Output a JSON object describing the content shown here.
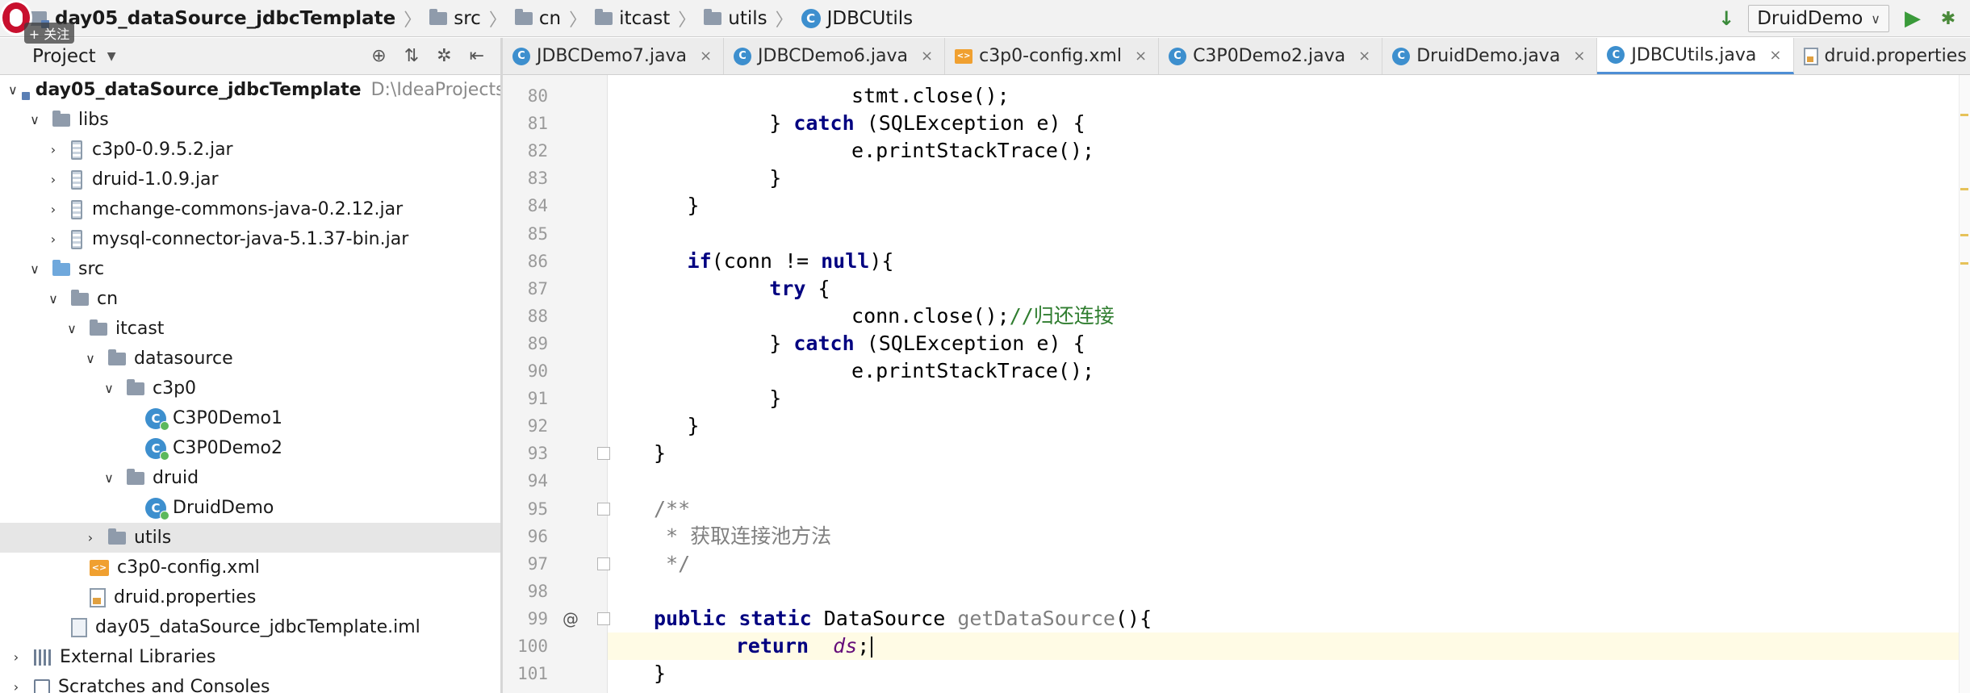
{
  "breadcrumb": {
    "items": [
      {
        "label": "day05_dataSource_jdbcTemplate",
        "icon": "module-icon",
        "bold": true
      },
      {
        "label": "src",
        "icon": "folder-icon"
      },
      {
        "label": "cn",
        "icon": "folder-icon"
      },
      {
        "label": "itcast",
        "icon": "folder-icon"
      },
      {
        "label": "utils",
        "icon": "folder-icon"
      },
      {
        "label": "JDBCUtils",
        "icon": "class-icon"
      }
    ],
    "separator": "〉"
  },
  "overlay": {
    "follow_label": "+ 关注"
  },
  "toolbar": {
    "run_config": "DruidDemo",
    "dropdown_glyph": "∨",
    "run_glyph": "▶",
    "debug_glyph": "✱",
    "build_glyph": "↓"
  },
  "project_panel": {
    "title": "Project",
    "tools": [
      "⊕",
      "⇅",
      "✲",
      "⇤"
    ],
    "tree": [
      {
        "label": "day05_dataSource_jdbcTemplate",
        "path": "D:\\IdeaProjects\\",
        "icon": "module-icon",
        "arrow": "∨",
        "level": 0,
        "bold": true
      },
      {
        "label": "libs",
        "icon": "folder-icon",
        "arrow": "∨",
        "level": 1
      },
      {
        "label": "c3p0-0.9.5.2.jar",
        "icon": "jar-icon",
        "arrow": "›",
        "level": 2
      },
      {
        "label": "druid-1.0.9.jar",
        "icon": "jar-icon",
        "arrow": "›",
        "level": 2
      },
      {
        "label": "mchange-commons-java-0.2.12.jar",
        "icon": "jar-icon",
        "arrow": "›",
        "level": 2
      },
      {
        "label": "mysql-connector-java-5.1.37-bin.jar",
        "icon": "jar-icon",
        "arrow": "›",
        "level": 2
      },
      {
        "label": "src",
        "icon": "source-folder-icon",
        "arrow": "∨",
        "level": 1
      },
      {
        "label": "cn",
        "icon": "folder-icon",
        "arrow": "∨",
        "level": 2
      },
      {
        "label": "itcast",
        "icon": "folder-icon",
        "arrow": "∨",
        "level": 3
      },
      {
        "label": "datasource",
        "icon": "folder-icon",
        "arrow": "∨",
        "level": 4
      },
      {
        "label": "c3p0",
        "icon": "folder-icon",
        "arrow": "∨",
        "level": 5
      },
      {
        "label": "C3P0Demo1",
        "icon": "class-icon",
        "arrow": "",
        "level": 6
      },
      {
        "label": "C3P0Demo2",
        "icon": "class-icon",
        "arrow": "",
        "level": 6
      },
      {
        "label": "druid",
        "icon": "folder-icon",
        "arrow": "∨",
        "level": 5
      },
      {
        "label": "DruidDemo",
        "icon": "class-icon",
        "arrow": "",
        "level": 6
      },
      {
        "label": "utils",
        "icon": "folder-icon",
        "arrow": "›",
        "level": 4,
        "selected": true
      },
      {
        "label": "c3p0-config.xml",
        "icon": "xml-icon",
        "arrow": "",
        "level": 3
      },
      {
        "label": "druid.properties",
        "icon": "properties-icon",
        "arrow": "",
        "level": 3
      },
      {
        "label": "day05_dataSource_jdbcTemplate.iml",
        "icon": "iml-icon",
        "arrow": "",
        "level": 2
      },
      {
        "label": "External Libraries",
        "icon": "libraries-icon",
        "arrow": "›",
        "level": 0
      },
      {
        "label": "Scratches and Consoles",
        "icon": "scratches-icon",
        "arrow": "›",
        "level": 0
      }
    ]
  },
  "editor_tabs": {
    "tabs": [
      {
        "label": "JDBCDemo7.java",
        "icon": "class-icon",
        "active": false
      },
      {
        "label": "JDBCDemo6.java",
        "icon": "class-icon",
        "active": false
      },
      {
        "label": "c3p0-config.xml",
        "icon": "xml-icon",
        "active": false
      },
      {
        "label": "C3P0Demo2.java",
        "icon": "class-icon",
        "active": false
      },
      {
        "label": "DruidDemo.java",
        "icon": "class-icon",
        "active": false
      },
      {
        "label": "JDBCUtils.java",
        "icon": "class-icon",
        "active": true
      },
      {
        "label": "druid.properties",
        "icon": "properties-icon",
        "active": false
      }
    ],
    "close_glyph": "×",
    "menu_glyph": "≡"
  },
  "editor": {
    "current_line": "100",
    "lines": [
      {
        "num": "80",
        "code": [
          {
            "t": "        stmt.close();",
            "c": ""
          }
        ]
      },
      {
        "num": "81",
        "code": [
          {
            "t": "    } ",
            "c": ""
          },
          {
            "t": "catch",
            "c": "kw"
          },
          {
            "t": " (SQLException e) {",
            "c": ""
          }
        ]
      },
      {
        "num": "82",
        "code": [
          {
            "t": "        e.printStackTrace();",
            "c": ""
          }
        ]
      },
      {
        "num": "83",
        "code": [
          {
            "t": "    }",
            "c": ""
          }
        ]
      },
      {
        "num": "84",
        "code": [
          {
            "t": "}",
            "c": ""
          }
        ]
      },
      {
        "num": "85",
        "code": []
      },
      {
        "num": "86",
        "code": [
          {
            "t": "if",
            "c": "kw"
          },
          {
            "t": "(conn != ",
            "c": ""
          },
          {
            "t": "null",
            "c": "kw"
          },
          {
            "t": "){",
            "c": ""
          }
        ]
      },
      {
        "num": "87",
        "code": [
          {
            "t": "    ",
            "c": ""
          },
          {
            "t": "try",
            "c": "kw"
          },
          {
            "t": " {",
            "c": ""
          }
        ]
      },
      {
        "num": "88",
        "code": [
          {
            "t": "        conn.close();",
            "c": ""
          },
          {
            "t": "//归还连接",
            "c": "cm-cn"
          }
        ]
      },
      {
        "num": "89",
        "code": [
          {
            "t": "    } ",
            "c": ""
          },
          {
            "t": "catch",
            "c": "kw"
          },
          {
            "t": " (SQLException e) {",
            "c": ""
          }
        ]
      },
      {
        "num": "90",
        "code": [
          {
            "t": "        e.printStackTrace();",
            "c": ""
          }
        ]
      },
      {
        "num": "91",
        "code": [
          {
            "t": "    }",
            "c": ""
          }
        ]
      },
      {
        "num": "92",
        "code": [
          {
            "t": "}",
            "c": ""
          }
        ]
      },
      {
        "num": "93",
        "code": [
          {
            "t": "}",
            "c": ""
          }
        ]
      },
      {
        "num": "94",
        "code": []
      },
      {
        "num": "95",
        "code": [
          {
            "t": "/**",
            "c": "cm"
          }
        ]
      },
      {
        "num": "96",
        "code": [
          {
            "t": " * 获取连接池方法",
            "c": "cm"
          }
        ]
      },
      {
        "num": "97",
        "code": [
          {
            "t": " */",
            "c": "cm"
          }
        ]
      },
      {
        "num": "98",
        "code": []
      },
      {
        "num": "99",
        "code": [
          {
            "t": "public",
            "c": "kw"
          },
          {
            "t": " ",
            "c": ""
          },
          {
            "t": "static",
            "c": "kw"
          },
          {
            "t": " DataSource ",
            "c": ""
          },
          {
            "t": "getDataSource",
            "c": "fn-gray"
          },
          {
            "t": "(){",
            "c": ""
          }
        ]
      },
      {
        "num": "100",
        "code": [
          {
            "t": "    ",
            "c": ""
          },
          {
            "t": "return",
            "c": "kw"
          },
          {
            "t": "  ",
            "c": ""
          },
          {
            "t": "ds",
            "c": "fld"
          },
          {
            "t": ";",
            "c": ""
          }
        ]
      },
      {
        "num": "101",
        "code": [
          {
            "t": "}",
            "c": ""
          }
        ]
      }
    ],
    "override_marker": "@"
  }
}
